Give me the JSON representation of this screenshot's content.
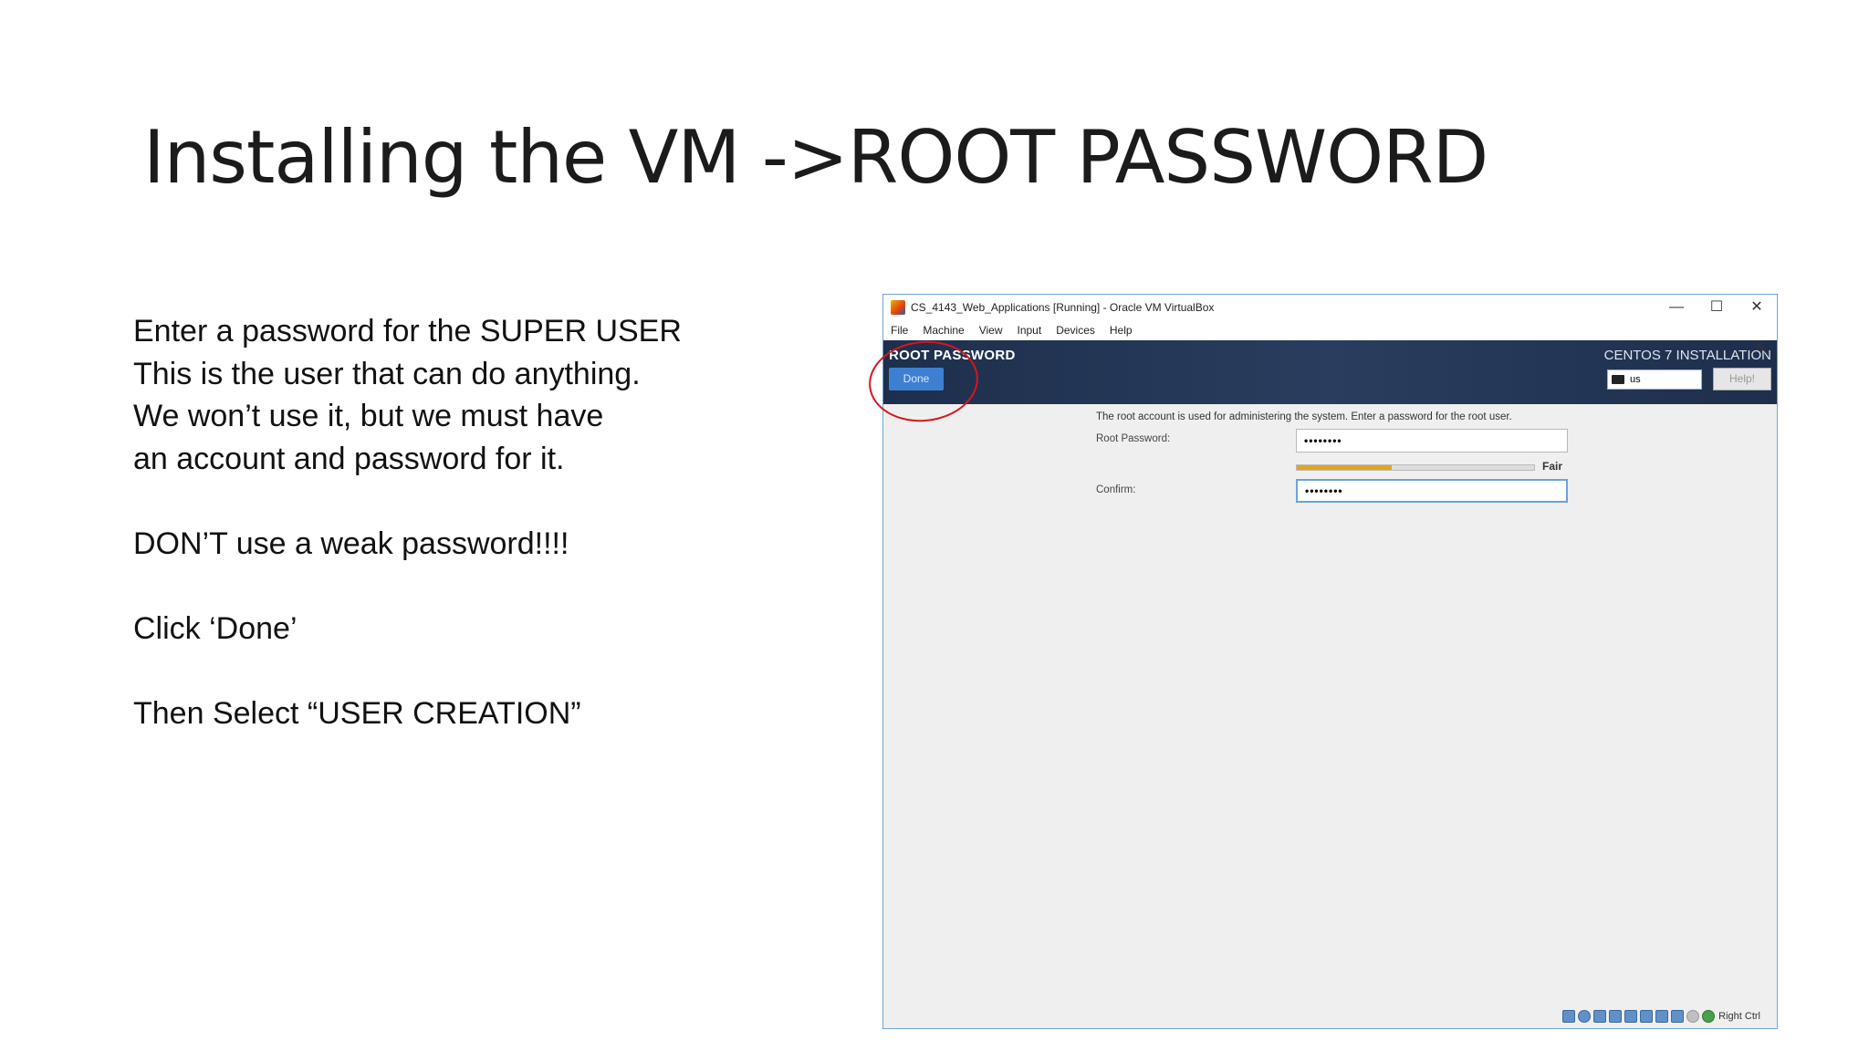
{
  "slide": {
    "title": "Installing the VM ->ROOT PASSWORD",
    "body": {
      "line1": "Enter a password for the SUPER USER",
      "line2": "This is the user that can do anything.",
      "line3": "We won’t use it, but we must have",
      "line4": "an account and password for it.",
      "line5": "DON’T use a weak password!!!!",
      "line6": "Click ‘Done’",
      "line7": "Then Select “USER CREATION”"
    }
  },
  "vm_window": {
    "title": "CS_4143_Web_Applications [Running] - Oracle VM VirtualBox",
    "controls": {
      "minimize": "—",
      "maximize": "☐",
      "close": "✕"
    },
    "menu": {
      "file": "File",
      "machine": "Machine",
      "view": "View",
      "input": "Input",
      "devices": "Devices",
      "help": "Help"
    },
    "installer": {
      "spoke_title": "ROOT PASSWORD",
      "done_label": "Done",
      "install_title": "CENTOS 7 INSTALLATION",
      "keyboard_layout": "us",
      "help_label": "Help!",
      "info_text": "The root account is used for administering the system.  Enter a password for the root user.",
      "root_password_label": "Root Password:",
      "root_password_value": "••••••••",
      "strength_label": "Fair",
      "strength_level": 0.4,
      "confirm_label": "Confirm:",
      "confirm_value": "••••••••"
    },
    "status_bar": {
      "host_key": "Right Ctrl"
    }
  },
  "icons": {
    "app": "virtualbox-icon",
    "keyboard": "keyboard-icon",
    "cursor": "mouse-pointer-icon"
  },
  "colors": {
    "header_bg": "#1d2f4c",
    "done_button": "#3f7fd2",
    "strength_fill": "#e0a520",
    "annotation": "#d8161b",
    "window_border": "#6ea4d6"
  }
}
